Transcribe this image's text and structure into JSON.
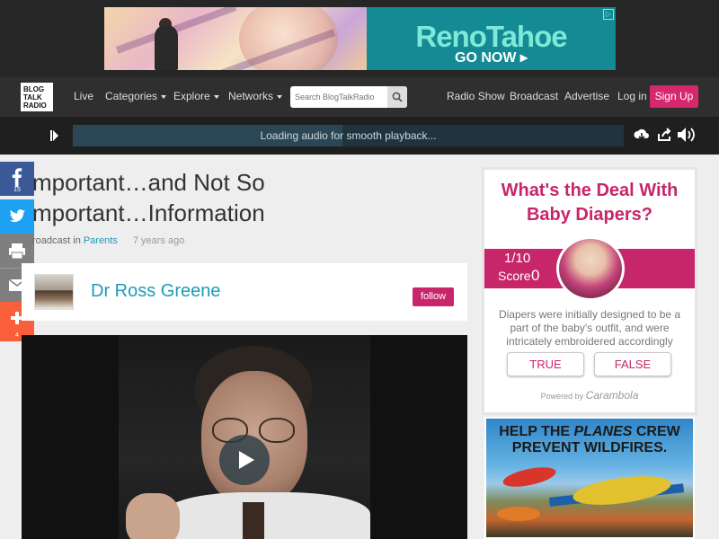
{
  "ad_top": {
    "brand": "RenoTahoe",
    "cta": "GO NOW ▸",
    "choice_icon": "ad-choices-icon",
    "colors": {
      "brand_bg": "#148a94",
      "brand_text": "#7fe9d9"
    }
  },
  "nav": {
    "logo": "BLOG TALK RADIO",
    "live": "Live",
    "categories": "Categories",
    "explore": "Explore",
    "networks": "Networks",
    "search_placeholder": "Search BlogTalkRadio",
    "radio_show": "Radio Show",
    "broadcast": "Broadcast",
    "advertise": "Advertise",
    "login": "Log in",
    "signup": "Sign Up",
    "colors": {
      "bar_bg": "#2f2f2f",
      "signup_bg": "#d6286c"
    }
  },
  "player": {
    "loading_text": "Loading audio for smooth playback...",
    "progress_fraction": 0.49,
    "icons": [
      "play-icon",
      "cloud-download-icon",
      "share-arrow-icon",
      "volume-icon"
    ]
  },
  "share": {
    "facebook": {
      "icon": "facebook-icon",
      "count": "15",
      "color": "#3b5998"
    },
    "twitter": {
      "icon": "twitter-icon",
      "color": "#1da1f2"
    },
    "print": {
      "icon": "print-icon",
      "color": "#7f7f7f"
    },
    "email": {
      "icon": "email-icon",
      "color": "#7f7f7f"
    },
    "more": {
      "icon": "plus-icon",
      "count": "4",
      "color": "#fb5e3b"
    }
  },
  "episode": {
    "title_line1": "mportant…and Not So",
    "title_line2": "mportant…Information",
    "meta_prefix": "roadcast in",
    "category": "Parents",
    "age": "7 years ago"
  },
  "host": {
    "name": "Dr Ross Greene",
    "follow": "follow"
  },
  "quiz": {
    "title": "What's the Deal With Baby Diapers?",
    "progress": "1/10",
    "score_label": "Score",
    "score_value": "0",
    "question": "Diapers were initially designed to be a part of the baby's outfit, and were intricately embroidered accordingly",
    "answer_true": "TRUE",
    "answer_false": "FALSE",
    "powered_prefix": "Powered by",
    "powered_brand": "Carambola",
    "accent": "#c8266a"
  },
  "ad_side": {
    "headline_pre": "HELP THE",
    "headline_em": "PLANES",
    "headline_post": "CREW PREVENT WILDFIRES."
  }
}
